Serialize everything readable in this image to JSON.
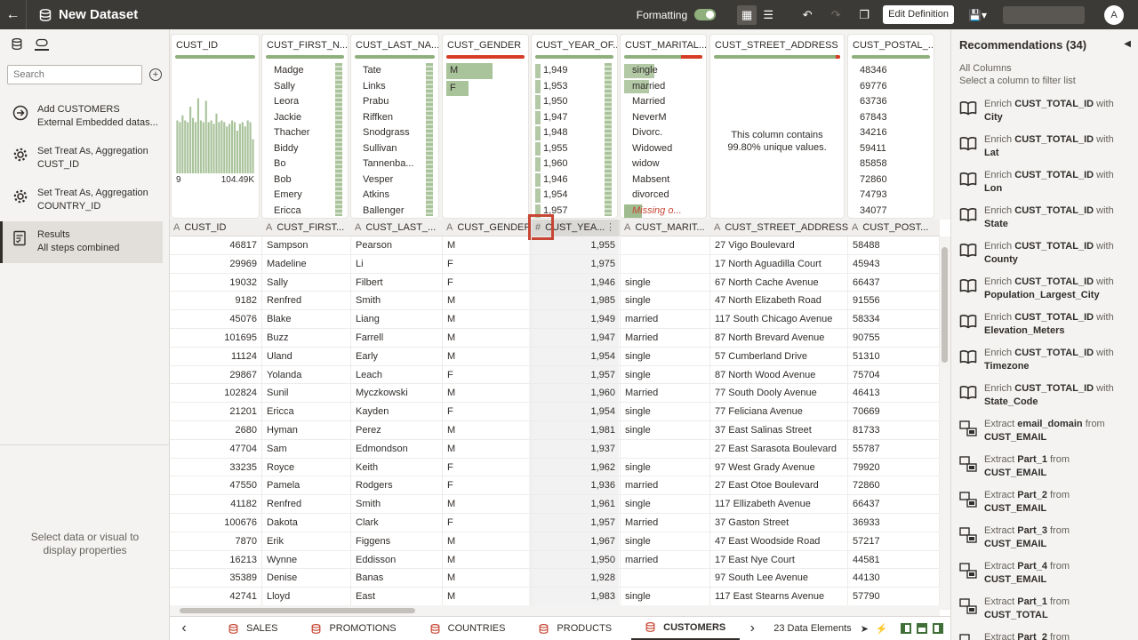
{
  "header": {
    "back_icon": "back-arrow-icon",
    "title": "New Dataset",
    "formatting_label": "Formatting",
    "edit_definition_label": "Edit Definition",
    "avatar_initial": "A"
  },
  "left": {
    "search_placeholder": "Search",
    "steps": [
      {
        "title": "Add CUSTOMERS",
        "subtitle": "External Embedded datas...",
        "icon": "add-step-icon"
      },
      {
        "title": "Set Treat As, Aggregation",
        "subtitle": "CUST_ID",
        "icon": "gear-icon"
      },
      {
        "title": "Set Treat As, Aggregation",
        "subtitle": "COUNTRY_ID",
        "icon": "gear-icon"
      },
      {
        "title": "Results",
        "subtitle": "All steps combined",
        "icon": "results-icon"
      }
    ],
    "properties_line1": "Select data or visual to",
    "properties_line2": "display properties"
  },
  "profiles": {
    "cust_id": {
      "title": "CUST_ID",
      "min": "9",
      "max": "104.49K",
      "histogram": [
        0.62,
        0.6,
        0.68,
        0.62,
        0.6,
        0.78,
        0.65,
        0.6,
        0.88,
        0.62,
        0.6,
        0.85,
        0.6,
        0.62,
        0.58,
        0.7,
        0.6,
        0.62,
        0.6,
        0.55,
        0.58,
        0.62,
        0.6,
        0.5,
        0.58,
        0.6,
        0.55,
        0.62,
        0.6,
        0.4
      ]
    },
    "first_name": {
      "title": "CUST_FIRST_N...",
      "values": [
        "Madge",
        "Sally",
        "Leora",
        "Jackie",
        "Thacher",
        "Biddy",
        "Bo",
        "Bob",
        "Emery",
        "Ericca"
      ]
    },
    "last_name": {
      "title": "CUST_LAST_NA...",
      "values": [
        "Tate",
        "Links",
        "Prabu",
        "Riffken",
        "Snodgrass",
        "Sullivan",
        "Tannenba...",
        "Vesper",
        "Atkins",
        "Ballenger"
      ]
    },
    "gender": {
      "title": "CUST_GENDER",
      "values": [
        {
          "label": "M",
          "share": 0.87
        },
        {
          "label": "F",
          "share": 0.42
        }
      ]
    },
    "year_of_birth": {
      "title": "CUST_YEAR_OF...",
      "values": [
        "1,949",
        "1,953",
        "1,950",
        "1,947",
        "1,948",
        "1,955",
        "1,960",
        "1,946",
        "1,954",
        "1,957"
      ]
    },
    "marital": {
      "title": "CUST_MARITAL...",
      "values": [
        "single",
        "married",
        "Married",
        "NeverM",
        "Divorc.",
        "Widowed",
        "widow",
        "Mabsent",
        "divorced"
      ],
      "missing_label": "Missing o..."
    },
    "street": {
      "title": "CUST_STREET_ADDRESS",
      "message": "This column contains 99.80% unique values."
    },
    "postal": {
      "title": "CUST_POSTAL_...",
      "values": [
        "48346",
        "69776",
        "63736",
        "67843",
        "34216",
        "59411",
        "85858",
        "72860",
        "74793",
        "34077"
      ]
    }
  },
  "columns": [
    {
      "type": "A",
      "name": "CUST_ID"
    },
    {
      "type": "A",
      "name": "CUST_FIRST..."
    },
    {
      "type": "A",
      "name": "CUST_LAST_..."
    },
    {
      "type": "A",
      "name": "CUST_GENDER"
    },
    {
      "type": "#",
      "name": "CUST_YEA..."
    },
    {
      "type": "A",
      "name": "CUST_MARIT..."
    },
    {
      "type": "A",
      "name": "CUST_STREET_ADDRESS"
    },
    {
      "type": "A",
      "name": "CUST_POST..."
    }
  ],
  "rows": [
    [
      "46817",
      "Sampson",
      "Pearson",
      "M",
      "1,955",
      "",
      "27 Vigo Boulevard",
      "58488"
    ],
    [
      "29969",
      "Madeline",
      "Li",
      "F",
      "1,975",
      "",
      "17 North Aguadilla Court",
      "45943"
    ],
    [
      "19032",
      "Sally",
      "Filbert",
      "F",
      "1,946",
      "single",
      "67 North Cache Avenue",
      "66437"
    ],
    [
      "9182",
      "Renfred",
      "Smith",
      "M",
      "1,985",
      "single",
      "47 North Elizabeth Road",
      "91556"
    ],
    [
      "45076",
      "Blake",
      "Liang",
      "M",
      "1,949",
      "married",
      "117 South Chicago Avenue",
      "58334"
    ],
    [
      "101695",
      "Buzz",
      "Farrell",
      "M",
      "1,947",
      "Married",
      "87 North Brevard Avenue",
      "90755"
    ],
    [
      "11124",
      "Uland",
      "Early",
      "M",
      "1,954",
      "single",
      "57 Cumberland Drive",
      "51310"
    ],
    [
      "29867",
      "Yolanda",
      "Leach",
      "F",
      "1,957",
      "single",
      "87 North Wood Avenue",
      "75704"
    ],
    [
      "102824",
      "Sunil",
      "Myczkowski",
      "M",
      "1,960",
      "Married",
      "77 South Dooly Avenue",
      "46413"
    ],
    [
      "21201",
      "Ericca",
      "Kayden",
      "F",
      "1,954",
      "single",
      "77 Feliciana Avenue",
      "70669"
    ],
    [
      "2680",
      "Hyman",
      "Perez",
      "M",
      "1,981",
      "single",
      "37 East Salinas Street",
      "81733"
    ],
    [
      "47704",
      "Sam",
      "Edmondson",
      "M",
      "1,937",
      "",
      "27 East Sarasota Boulevard",
      "55787"
    ],
    [
      "33235",
      "Royce",
      "Keith",
      "F",
      "1,962",
      "single",
      "97 West Grady Avenue",
      "79920"
    ],
    [
      "47550",
      "Pamela",
      "Rodgers",
      "F",
      "1,936",
      "married",
      "27 East Otoe Boulevard",
      "72860"
    ],
    [
      "41182",
      "Renfred",
      "Smith",
      "M",
      "1,961",
      "single",
      "117 Ellizabeth Avenue",
      "66437"
    ],
    [
      "100676",
      "Dakota",
      "Clark",
      "F",
      "1,957",
      "Married",
      "37 Gaston Street",
      "36933"
    ],
    [
      "7870",
      "Erik",
      "Figgens",
      "M",
      "1,967",
      "single",
      "47 East Woodside Road",
      "57217"
    ],
    [
      "16213",
      "Wynne",
      "Eddisson",
      "M",
      "1,950",
      "married",
      "17 East Nye Court",
      "44581"
    ],
    [
      "35389",
      "Denise",
      "Banas",
      "M",
      "1,928",
      "",
      "97 South Lee Avenue",
      "44130"
    ],
    [
      "42741",
      "Lloyd",
      "East",
      "M",
      "1,983",
      "single",
      "117 East Stearns Avenue",
      "57790"
    ]
  ],
  "bottom": {
    "tabs": [
      "SALES",
      "PROMOTIONS",
      "COUNTRIES",
      "PRODUCTS",
      "CUSTOMERS"
    ],
    "active_tab": "CUSTOMERS",
    "data_elements": "23 Data Elements"
  },
  "recommendations": {
    "title": "Recommendations (34)",
    "subtitle_line1": "All Columns",
    "subtitle_line2": "Select a column to filter list",
    "items": [
      {
        "icon": "book-icon",
        "verb": "Enrich",
        "column": "CUST_TOTAL_ID",
        "joiner": "with",
        "target": "City"
      },
      {
        "icon": "book-icon",
        "verb": "Enrich",
        "column": "CUST_TOTAL_ID",
        "joiner": "with",
        "target": "Lat"
      },
      {
        "icon": "book-icon",
        "verb": "Enrich",
        "column": "CUST_TOTAL_ID",
        "joiner": "with",
        "target": "Lon"
      },
      {
        "icon": "book-icon",
        "verb": "Enrich",
        "column": "CUST_TOTAL_ID",
        "joiner": "with",
        "target": "State"
      },
      {
        "icon": "book-icon",
        "verb": "Enrich",
        "column": "CUST_TOTAL_ID",
        "joiner": "with",
        "target": "County"
      },
      {
        "icon": "book-icon",
        "verb": "Enrich",
        "column": "CUST_TOTAL_ID",
        "joiner": "with",
        "target": "Population_Largest_City"
      },
      {
        "icon": "book-icon",
        "verb": "Enrich",
        "column": "CUST_TOTAL_ID",
        "joiner": "with",
        "target": "Elevation_Meters"
      },
      {
        "icon": "book-icon",
        "verb": "Enrich",
        "column": "CUST_TOTAL_ID",
        "joiner": "with",
        "target": "Timezone"
      },
      {
        "icon": "book-icon",
        "verb": "Enrich",
        "column": "CUST_TOTAL_ID",
        "joiner": "with",
        "target": "State_Code"
      },
      {
        "icon": "extract-icon",
        "verb": "Extract",
        "column": "email_domain",
        "joiner": "from",
        "target": "CUST_EMAIL"
      },
      {
        "icon": "extract-icon",
        "verb": "Extract",
        "column": "Part_1",
        "joiner": "from",
        "target": "CUST_EMAIL"
      },
      {
        "icon": "extract-icon",
        "verb": "Extract",
        "column": "Part_2",
        "joiner": "from",
        "target": "CUST_EMAIL"
      },
      {
        "icon": "extract-icon",
        "verb": "Extract",
        "column": "Part_3",
        "joiner": "from",
        "target": "CUST_EMAIL"
      },
      {
        "icon": "extract-icon",
        "verb": "Extract",
        "column": "Part_4",
        "joiner": "from",
        "target": "CUST_EMAIL"
      },
      {
        "icon": "extract-icon",
        "verb": "Extract",
        "column": "Part_1",
        "joiner": "from",
        "target": "CUST_TOTAL"
      },
      {
        "icon": "extract-icon",
        "verb": "Extract",
        "column": "Part_2",
        "joiner": "from",
        "target": ""
      }
    ]
  },
  "colors": {
    "accent_green": "#8fb07c",
    "error_red": "#d63b25",
    "highlight_red": "#c74634",
    "topbar": "#3c3a37"
  }
}
